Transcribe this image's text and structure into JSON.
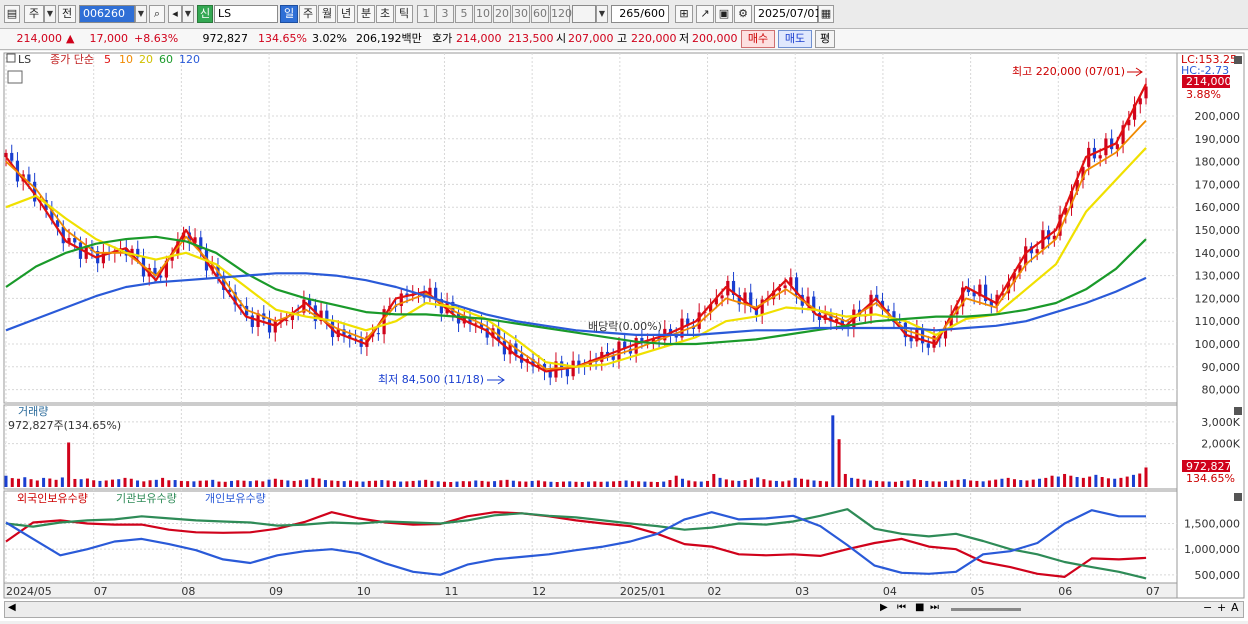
{
  "toolbar": {
    "type_label": "주",
    "prev_label": "전",
    "code": "006260",
    "shin": "신",
    "name": "LS",
    "periods": [
      "일",
      "주",
      "월",
      "년",
      "분",
      "초",
      "틱"
    ],
    "period_selected": "일",
    "intervals": [
      "1",
      "3",
      "5",
      "10",
      "20",
      "30",
      "60",
      "120"
    ],
    "count": "265",
    "count_total": "/600",
    "date": "2025/07/01"
  },
  "quote": {
    "price": "214,000",
    "change": "17,000",
    "change_pct": "+8.63%",
    "volume": "972,827",
    "vol_ratio": "134.65%",
    "turnover_pct": "3.02%",
    "amount": "206,192백만",
    "hoga_label": "호가",
    "bid": "214,000",
    "ask": "213,500",
    "open_label": "시",
    "open": "207,000",
    "high_label": "고",
    "high": "220,000",
    "low_label": "저",
    "low": "200,000",
    "buy_label": "매수",
    "sell_label": "매도",
    "flat_label": "평"
  },
  "colors": {
    "up": "#d0021b",
    "down": "#1a3fd0",
    "ma5": "#e01010",
    "ma10": "#f08a00",
    "ma20": "#f0e000",
    "ma60": "#1a9a2a",
    "ma120": "#2a5ad8",
    "foreign": "#d0021b",
    "inst": "#2e8b57",
    "indiv": "#2a5ad8"
  },
  "price_panel": {
    "stock": "LS",
    "ma_title": "종가 단순",
    "ma_periods": [
      "5",
      "10",
      "20",
      "60",
      "120"
    ],
    "lc": "LC:153.25",
    "hc": "HC:-2.73",
    "last_price_tag": "214,000",
    "last_pct_tag": "3.88%",
    "high_annot": "최고 220,000 (07/01)",
    "low_annot": "최저 84,500 (11/18)",
    "div_annot": "배당락(0.00%)"
  },
  "volume_panel": {
    "title": "거래량",
    "value": "972,827주(134.65%)",
    "last_tag": "972,827",
    "last_pct": "134.65%"
  },
  "investor_panel": {
    "items": [
      "외국인보유수량",
      "기관보유수량",
      "개인보유수량"
    ]
  },
  "chart_data": {
    "type": "line",
    "title": "LS",
    "x": [
      "2024/05",
      "07",
      "08",
      "09",
      "10",
      "11",
      "12",
      "2025/01",
      "02",
      "03",
      "04",
      "05",
      "06",
      "07"
    ],
    "price_ticks": [
      "200,000",
      "190,000",
      "180,000",
      "170,000",
      "160,000",
      "150,000",
      "140,000",
      "130,000",
      "120,000",
      "110,000",
      "100,000",
      "90,000",
      "80,000"
    ],
    "ylim": [
      75000,
      225000
    ],
    "series": [
      {
        "name": "5",
        "values": [
          182000,
          165000,
          145000,
          138000,
          142000,
          128000,
          150000,
          130000,
          112000,
          108000,
          118000,
          105000,
          100000,
          120000,
          123000,
          112000,
          106000,
          95000,
          88000,
          90000,
          95000,
          100000,
          104000,
          110000,
          125000,
          115000,
          128000,
          113000,
          108000,
          120000,
          104000,
          100000,
          125000,
          118000,
          140000,
          150000,
          182000,
          188000,
          214000
        ]
      },
      {
        "name": "10",
        "values": [
          180000,
          168000,
          150000,
          140000,
          140000,
          130000,
          147000,
          133000,
          115000,
          110000,
          115000,
          107000,
          102000,
          117000,
          122000,
          114000,
          108000,
          98000,
          89000,
          90000,
          94000,
          98000,
          103000,
          108000,
          120000,
          116000,
          124000,
          115000,
          110000,
          118000,
          106000,
          102000,
          120000,
          116000,
          135000,
          146000,
          176000,
          184000,
          198000
        ]
      },
      {
        "name": "20",
        "values": [
          160000,
          165000,
          155000,
          146000,
          140000,
          137000,
          140000,
          135000,
          125000,
          115000,
          112000,
          110000,
          106000,
          110000,
          118000,
          116000,
          111000,
          102000,
          92000,
          90000,
          91000,
          95000,
          99000,
          103000,
          110000,
          112000,
          116000,
          115000,
          112000,
          113000,
          110000,
          104000,
          111000,
          113000,
          124000,
          135000,
          158000,
          172000,
          186000
        ]
      },
      {
        "name": "60",
        "values": [
          125000,
          134000,
          140000,
          144000,
          146000,
          147000,
          145000,
          140000,
          131000,
          124000,
          120000,
          117000,
          114000,
          113000,
          113000,
          112000,
          111000,
          109000,
          107000,
          105000,
          103000,
          101000,
          100000,
          100000,
          101000,
          102000,
          104000,
          106000,
          108000,
          110000,
          111000,
          112000,
          112000,
          113000,
          115000,
          118000,
          124000,
          133000,
          146000
        ]
      },
      {
        "name": "120",
        "values": [
          106000,
          111000,
          116000,
          121000,
          125000,
          127000,
          128000,
          129000,
          130000,
          131000,
          131000,
          130000,
          128000,
          125000,
          121000,
          117000,
          113000,
          110000,
          108000,
          106000,
          105000,
          104000,
          104000,
          104000,
          105000,
          106000,
          106000,
          107000,
          107000,
          107000,
          107000,
          106000,
          107000,
          108000,
          110000,
          114000,
          118000,
          123000,
          129000
        ]
      }
    ],
    "volume_ticks": [
      "3,000K",
      "2,000K"
    ],
    "volume_ylim": [
      0,
      3500000
    ],
    "volume": [
      520,
      410,
      380,
      450,
      360,
      300,
      420,
      390,
      330,
      440,
      2050,
      370,
      360,
      390,
      310,
      280,
      300,
      340,
      360,
      420,
      380,
      300,
      260,
      310,
      330,
      420,
      310,
      320,
      280,
      270,
      260,
      290,
      300,
      330,
      250,
      240,
      280,
      310,
      290,
      270,
      300,
      260,
      340,
      380,
      330,
      300,
      280,
      310,
      350,
      420,
      390,
      320,
      300,
      280,
      270,
      300,
      260,
      250,
      280,
      290,
      320,
      300,
      270,
      250,
      260,
      280,
      300,
      330,
      280,
      260,
      240,
      230,
      250,
      270,
      260,
      300,
      280,
      250,
      270,
      310,
      330,
      290,
      260,
      250,
      280,
      300,
      260,
      240,
      230,
      250,
      260,
      240,
      230,
      250,
      260,
      240,
      250,
      260,
      280,
      300,
      270,
      260,
      250,
      240,
      230,
      250,
      320,
      520,
      380,
      300,
      260,
      250,
      280,
      600,
      420,
      350,
      300,
      280,
      320,
      380,
      440,
      360,
      300,
      280,
      260,
      300,
      420,
      380,
      340,
      300,
      280,
      260,
      3300,
      2200,
      600,
      420,
      380,
      340,
      300,
      280,
      260,
      250,
      240,
      280,
      300,
      360,
      320,
      280,
      260,
      250,
      270,
      300,
      330,
      360,
      300,
      280,
      260,
      300,
      340,
      380,
      420,
      360,
      320,
      300,
      340,
      380,
      420,
      520,
      480,
      600,
      520,
      460,
      420,
      480,
      560,
      460,
      400,
      380,
      420,
      480,
      560,
      620,
      900
    ],
    "investor_ticks": [
      "1,500,000",
      "1,000,000",
      "500,000"
    ],
    "investor_ylim": [
      380000,
      1900000
    ],
    "investor_series": [
      {
        "name": "외국인보유수량",
        "values": [
          1150000,
          1520000,
          1560000,
          1500000,
          1480000,
          1480000,
          1380000,
          1330000,
          1320000,
          1330000,
          1400000,
          1530000,
          1720000,
          1600000,
          1520000,
          1480000,
          1490000,
          1640000,
          1720000,
          1700000,
          1640000,
          1560000,
          1500000,
          1450000,
          1300000,
          1100000,
          1050000,
          900000,
          880000,
          900000,
          870000,
          1000000,
          1120000,
          1200000,
          1050000,
          1000000,
          750000,
          650000,
          520000,
          460000,
          820000,
          800000,
          830000
        ]
      },
      {
        "name": "기관보유수량",
        "values": [
          1500000,
          1440000,
          1520000,
          1560000,
          1580000,
          1640000,
          1600000,
          1560000,
          1540000,
          1520000,
          1460000,
          1480000,
          1520000,
          1500000,
          1540000,
          1520000,
          1500000,
          1560000,
          1660000,
          1700000,
          1650000,
          1620000,
          1560000,
          1500000,
          1450000,
          1380000,
          1420000,
          1500000,
          1480000,
          1540000,
          1650000,
          1780000,
          1400000,
          1300000,
          1250000,
          1300000,
          1160000,
          1000000,
          900000,
          750000,
          650000,
          560000,
          430000
        ]
      },
      {
        "name": "개인보유수량",
        "values": [
          1520000,
          1200000,
          880000,
          1000000,
          1150000,
          1200000,
          1100000,
          980000,
          800000,
          730000,
          880000,
          960000,
          1000000,
          920000,
          720000,
          560000,
          500000,
          700000,
          800000,
          850000,
          900000,
          980000,
          1050000,
          1150000,
          1300000,
          1580000,
          1720000,
          1580000,
          1600000,
          1650000,
          1450000,
          1080000,
          680000,
          540000,
          520000,
          560000,
          900000,
          960000,
          1120000,
          1500000,
          1760000,
          1640000,
          1640000
        ]
      }
    ]
  }
}
